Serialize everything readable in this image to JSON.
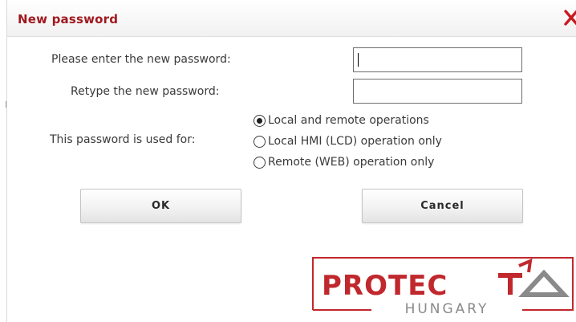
{
  "dialog": {
    "title": "New password",
    "close_icon": "close-icon"
  },
  "form": {
    "new_password_label": "Please enter the new password:",
    "new_password_value": "",
    "retype_label": "Retype the new password:",
    "retype_value": "",
    "usage_label": "This password is used for:",
    "options": [
      {
        "label": "Local and remote operations",
        "checked": true
      },
      {
        "label": "Local HMI (LCD) operation only",
        "checked": false
      },
      {
        "label": "Remote (WEB) operation only",
        "checked": false
      }
    ]
  },
  "buttons": {
    "ok_label": "OK",
    "cancel_label": "Cancel"
  },
  "logo": {
    "name": "PROTECTA",
    "sub": "HUNGARY",
    "colors": {
      "red": "#c0282d",
      "gray": "#8a8a8a"
    }
  },
  "colors": {
    "title": "#a0191f",
    "close": "#c8191f",
    "text": "#3a3a3a"
  }
}
